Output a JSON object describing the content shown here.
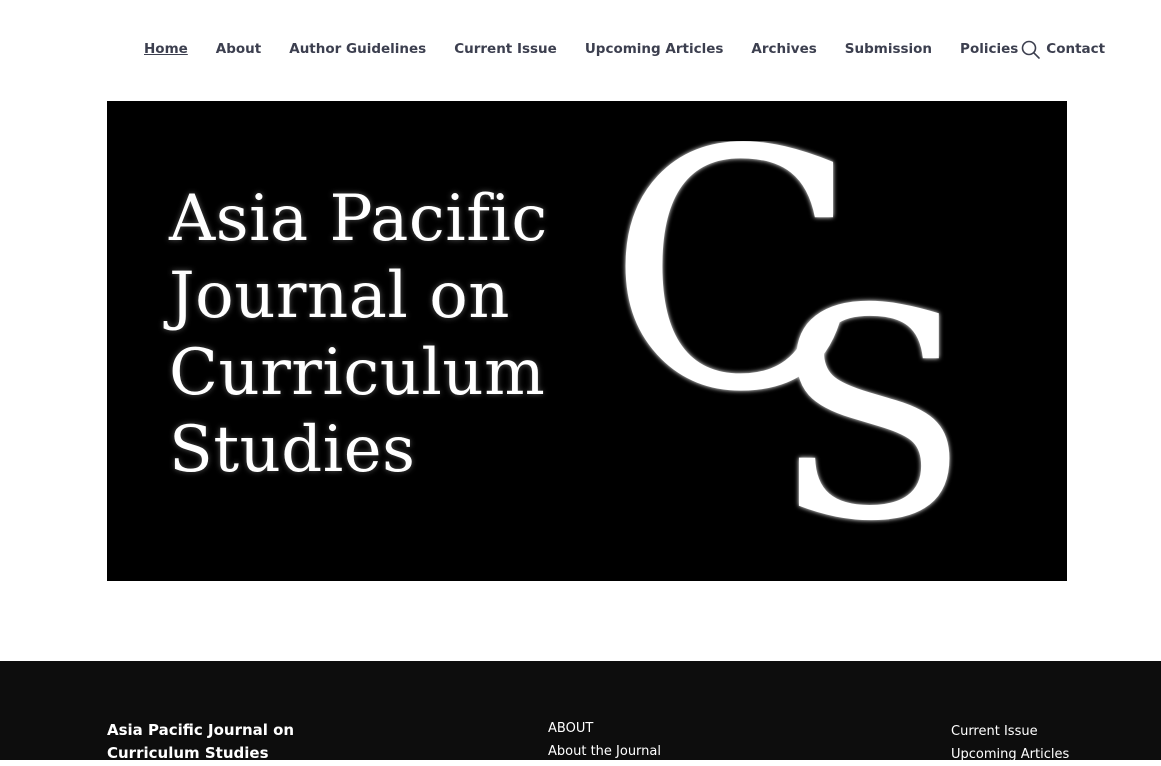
{
  "nav": {
    "items": [
      {
        "label": "Home",
        "active": true
      },
      {
        "label": "About"
      },
      {
        "label": "Author Guidelines"
      },
      {
        "label": "Current Issue"
      },
      {
        "label": "Upcoming Articles"
      },
      {
        "label": "Archives"
      },
      {
        "label": "Submission"
      },
      {
        "label": "Policies"
      },
      {
        "label": "Contact"
      }
    ],
    "search_icon": "search-icon"
  },
  "banner": {
    "title_lines": [
      "Asia Pacific",
      "Journal on",
      "Curriculum",
      "Studies"
    ],
    "logo_letters": "CS",
    "background": "#000000"
  },
  "footer": {
    "brand": "Asia Pacific Journal on Curriculum Studies",
    "about_heading": "ABOUT",
    "about_links": [
      "About the Journal"
    ],
    "right_links": [
      "Current Issue",
      "Upcoming Articles"
    ],
    "background": "#0d0d0d"
  }
}
